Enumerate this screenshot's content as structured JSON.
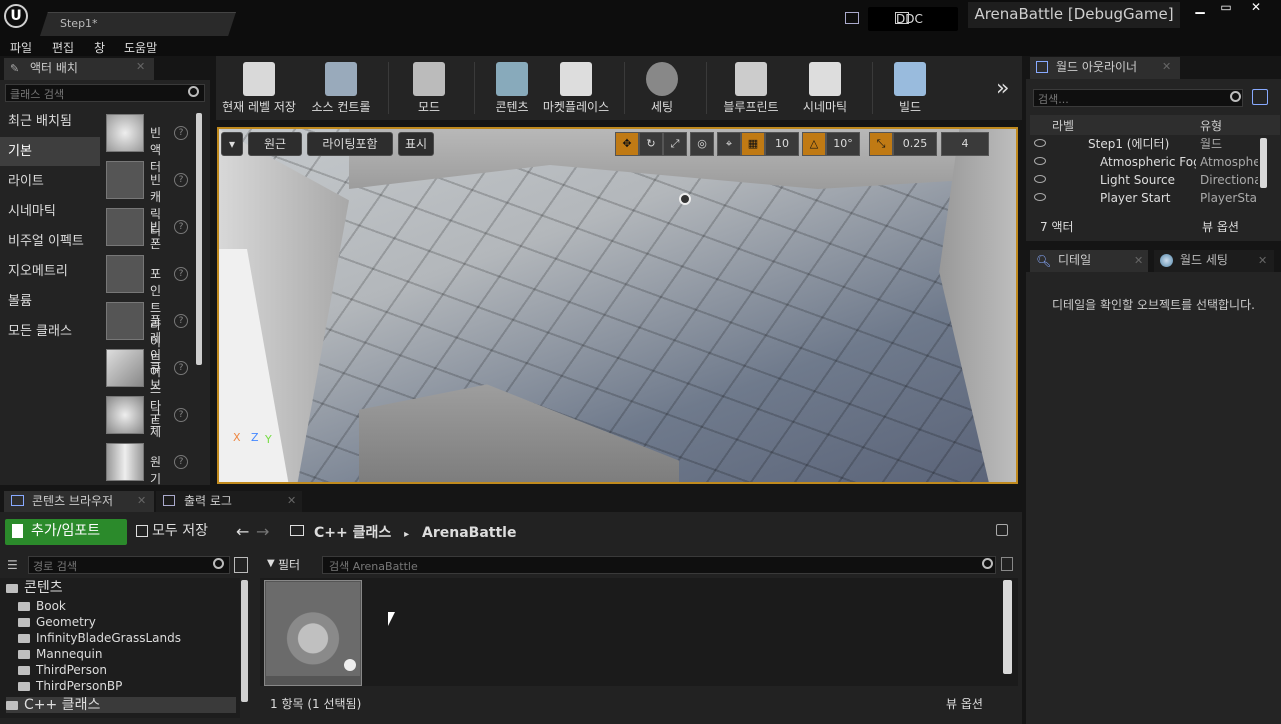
{
  "app": {
    "tab_title": "Step1*",
    "ddc_label": "DDC",
    "project_title": "ArenaBattle [DebugGame]"
  },
  "menu": [
    "파일",
    "편집",
    "창",
    "도움말"
  ],
  "place_actors": {
    "tab_label": "액터 배치",
    "search_placeholder": "클래스 검색",
    "categories": [
      "최근 배치됨",
      "기본",
      "라이트",
      "시네마틱",
      "비주얼 이펙트",
      "지오메트리",
      "볼륨",
      "모든 클래스"
    ],
    "active_category": "기본",
    "items": [
      "빈 액터",
      "빈 캐릭터",
      "빈 폰",
      "포인트 라이트",
      "플레이어 스타트",
      "큐브",
      "구체",
      "원기둥"
    ]
  },
  "toolbar": {
    "buttons": [
      "현재 레벨 저장",
      "소스 컨트롤",
      "모드",
      "콘텐츠",
      "마켓플레이스",
      "세팅",
      "블루프린트",
      "시네마틱",
      "빌드"
    ],
    "more": "»"
  },
  "viewport": {
    "view_mode": "원근",
    "lighting": "라이팅포함",
    "show": "표시",
    "grid_snap": "10",
    "rotation_snap": "10°",
    "scale_snap": "0.25",
    "camera_speed": "4",
    "axis_labels": [
      "X",
      "Z",
      "Y"
    ]
  },
  "outliner": {
    "tab_label": "월드 아웃라이너",
    "search_placeholder": "검색...",
    "col_label": "라벨",
    "col_type": "유형",
    "rows": [
      {
        "name": "Step1 (에디터)",
        "type": "월드"
      },
      {
        "name": "Atmospheric Fog",
        "type": "AtmosphericFog"
      },
      {
        "name": "Light Source",
        "type": "DirectionalLight"
      },
      {
        "name": "Player Start",
        "type": "PlayerStart"
      }
    ],
    "actor_count": "7 액터",
    "view_options": "뷰 옵션"
  },
  "details": {
    "tab_label": "디테일",
    "world_settings_label": "월드 세팅",
    "empty_message": "디테일을 확인할 오브젝트를 선택합니다."
  },
  "bottom_tabs": {
    "content_browser": "콘텐츠 브라우저",
    "output_log": "출력 로그"
  },
  "content_browser": {
    "add_import": "추가/임포트",
    "save_all": "모두 저장",
    "path": [
      "C++ 클래스",
      "ArenaBattle"
    ],
    "tree_search_placeholder": "경로 검색",
    "filter_label": "필터",
    "asset_search_placeholder": "검색 ArenaBattle",
    "tree": {
      "root": "콘텐츠",
      "folders": [
        "Book",
        "Geometry",
        "InfinityBladeGrassLands",
        "Mannequin",
        "ThirdPerson",
        "ThirdPersonBP"
      ],
      "cpp": "C++ 클래스"
    },
    "item_count": "1 항목 (1 선택됨)",
    "view_options": "뷰 옵션"
  }
}
